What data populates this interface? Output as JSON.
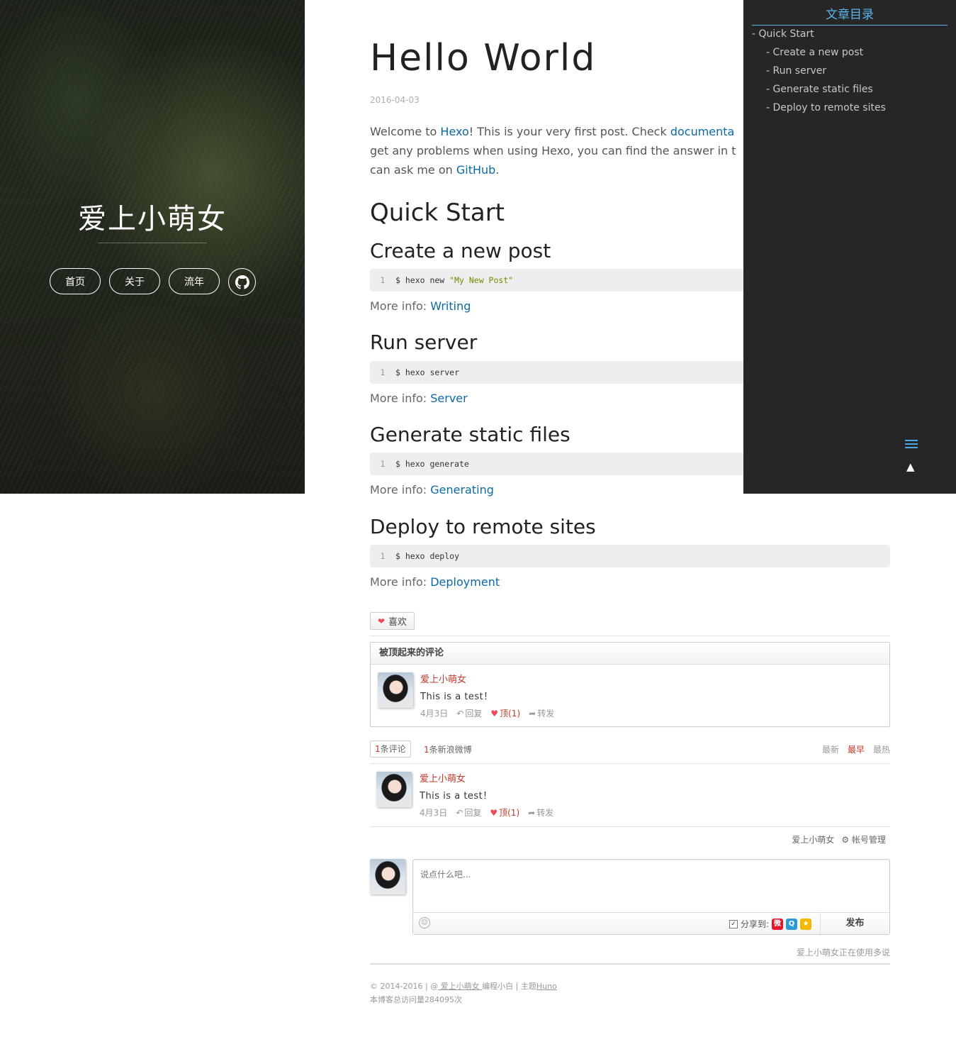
{
  "hero": {
    "title": "爱上小萌女",
    "nav": [
      {
        "label": "首页"
      },
      {
        "label": "关于"
      },
      {
        "label": "流年"
      }
    ],
    "github_icon": "github-icon"
  },
  "post": {
    "title": "Hello World",
    "date": "2016-04-03",
    "intro": {
      "t1": "Welcome to ",
      "hexo": "Hexo",
      "t2": "! This is your very first post. Check ",
      "docs": "documenta",
      "t3": "get any problems when using Hexo, you can find the answer in t",
      "t4": "can ask me on ",
      "github": "GitHub",
      "t5": "."
    },
    "quick_start": "Quick Start",
    "sections": [
      {
        "heading": "Create a new post",
        "line_no": "1",
        "code_prefix": "$ hexo new ",
        "code_string": "\"My New Post\"",
        "more_label": "More info: ",
        "more_link": "Writing"
      },
      {
        "heading": "Run server",
        "line_no": "1",
        "code_prefix": "$ hexo server",
        "code_string": "",
        "more_label": "More info: ",
        "more_link": "Server"
      },
      {
        "heading": "Generate static files",
        "line_no": "1",
        "code_prefix": "$ hexo generate",
        "code_string": "",
        "more_label": "More info: ",
        "more_link": "Generating"
      },
      {
        "heading": "Deploy to remote sites",
        "line_no": "1",
        "code_prefix": "$ hexo deploy",
        "code_string": "",
        "more_label": "More info: ",
        "more_link": "Deployment"
      }
    ]
  },
  "toc": {
    "title": "文章目录",
    "items": [
      {
        "label": "- Quick Start"
      },
      {
        "label": "- Create a new post"
      },
      {
        "label": "- Run server"
      },
      {
        "label": "- Generate static files"
      },
      {
        "label": "- Deploy to remote sites"
      }
    ],
    "menu_icon": "menu-icon",
    "top_label": "▲"
  },
  "like": {
    "label": "喜欢"
  },
  "comments": {
    "hot_title": "被顶起来的评论",
    "hot": {
      "author": "爱上小萌女",
      "text": "This is a test！",
      "date": "4月3日",
      "reply": "回复",
      "up": "顶(1)",
      "share": "转发"
    },
    "count_num": "1",
    "count_label": "条评论",
    "weibo_num": "1",
    "weibo_label": "条新浪微博",
    "sort": {
      "newest": "最新",
      "oldest": "最早",
      "hottest": "最热"
    },
    "list": [
      {
        "author": "爱上小萌女",
        "text": "This is a test！",
        "date": "4月3日",
        "reply": "回复",
        "up": "顶(1)",
        "share": "转发"
      }
    ],
    "account_name": "爱上小萌女",
    "account_manage": "帐号管理",
    "placeholder": "说点什么吧...",
    "share_label": "分享到:",
    "publish": "发布",
    "powered": "爱上小萌女正在使用多说"
  },
  "footer": {
    "line1_a": "© 2014-2016 | @",
    "line1_name": " 爱上小萌女 ",
    "line1_b": "编程小白 | 主题",
    "line1_theme": "Huno",
    "line2": "本博客总访问量284095次"
  },
  "colors": {
    "link": "#0a6aa1",
    "toc_accent": "#5bb4ec",
    "comment_accent": "#c0392b",
    "toc_bg": "#262626"
  }
}
